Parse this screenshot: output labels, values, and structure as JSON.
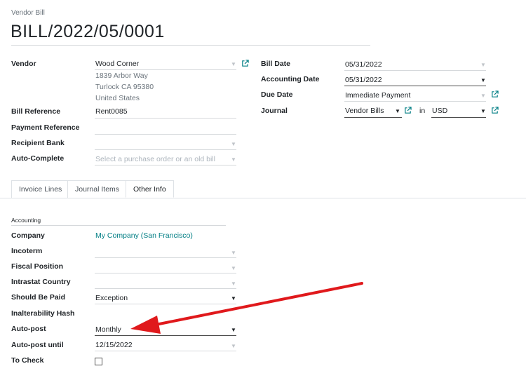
{
  "header": {
    "breadcrumb": "Vendor Bill",
    "title": "BILL/2022/05/0001"
  },
  "left": {
    "vendor_label": "Vendor",
    "vendor_value": "Wood Corner",
    "address_line1": "1839 Arbor Way",
    "address_line2": "Turlock CA 95380",
    "address_line3": "United States",
    "bill_ref_label": "Bill Reference",
    "bill_ref_value": "Rent0085",
    "payment_ref_label": "Payment Reference",
    "payment_ref_value": "",
    "recipient_bank_label": "Recipient Bank",
    "recipient_bank_value": "",
    "auto_complete_label": "Auto-Complete",
    "auto_complete_placeholder": "Select a purchase order or an old bill"
  },
  "right": {
    "bill_date_label": "Bill Date",
    "bill_date_value": "05/31/2022",
    "accounting_date_label": "Accounting Date",
    "accounting_date_value": "05/31/2022",
    "due_date_label": "Due Date",
    "due_date_value": "Immediate Payment",
    "journal_label": "Journal",
    "journal_value": "Vendor Bills",
    "in_text": "in",
    "currency_value": "USD"
  },
  "tabs": [
    {
      "label": "Invoice Lines",
      "active": false
    },
    {
      "label": "Journal Items",
      "active": false
    },
    {
      "label": "Other Info",
      "active": true
    }
  ],
  "other_info": {
    "section_title": "Accounting",
    "company_label": "Company",
    "company_value": "My Company (San Francisco)",
    "incoterm_label": "Incoterm",
    "fiscal_position_label": "Fiscal Position",
    "intrastat_label": "Intrastat Country",
    "should_be_paid_label": "Should Be Paid",
    "should_be_paid_value": "Exception",
    "hash_label": "Inalterability Hash",
    "auto_post_label": "Auto-post",
    "auto_post_value": "Monthly",
    "auto_post_until_label": "Auto-post until",
    "auto_post_until_value": "12/15/2022",
    "to_check_label": "To Check",
    "to_check_checked": false
  },
  "annotation": {
    "arrow_color": "#e0191c"
  },
  "colors": {
    "link": "#017e84",
    "text": "#212529",
    "border": "#dee2e6"
  }
}
